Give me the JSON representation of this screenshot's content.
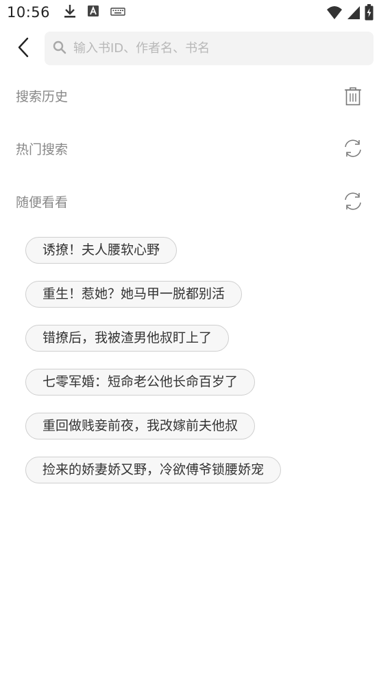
{
  "status_bar": {
    "time": "10:56",
    "icons_left": [
      "download-icon",
      "font-a-icon",
      "keyboard-icon"
    ],
    "icons_right": [
      "wifi-icon",
      "signal-icon",
      "battery-charging-icon"
    ]
  },
  "header": {
    "back_icon": "chevron-left-icon",
    "search": {
      "placeholder": "输入书ID、作者名、书名",
      "value": ""
    }
  },
  "sections": {
    "history": {
      "title": "搜索历史",
      "action_icon": "trash-icon"
    },
    "hot": {
      "title": "热门搜索",
      "action_icon": "refresh-icon"
    },
    "random": {
      "title": "随便看看",
      "action_icon": "refresh-icon"
    }
  },
  "random_books": [
    "诱撩！夫人腰软心野",
    "重生！惹她？她马甲一脱都别活",
    "错撩后，我被渣男他叔盯上了",
    "七零军婚：短命老公他长命百岁了",
    "重回做贱妾前夜，我改嫁前夫他叔",
    "捡来的娇妻娇又野，冷欲傅爷锁腰娇宠"
  ],
  "colors": {
    "section_title": "#888888",
    "chip_border": "#cfcfcf",
    "search_bg": "#f3f3f3"
  }
}
